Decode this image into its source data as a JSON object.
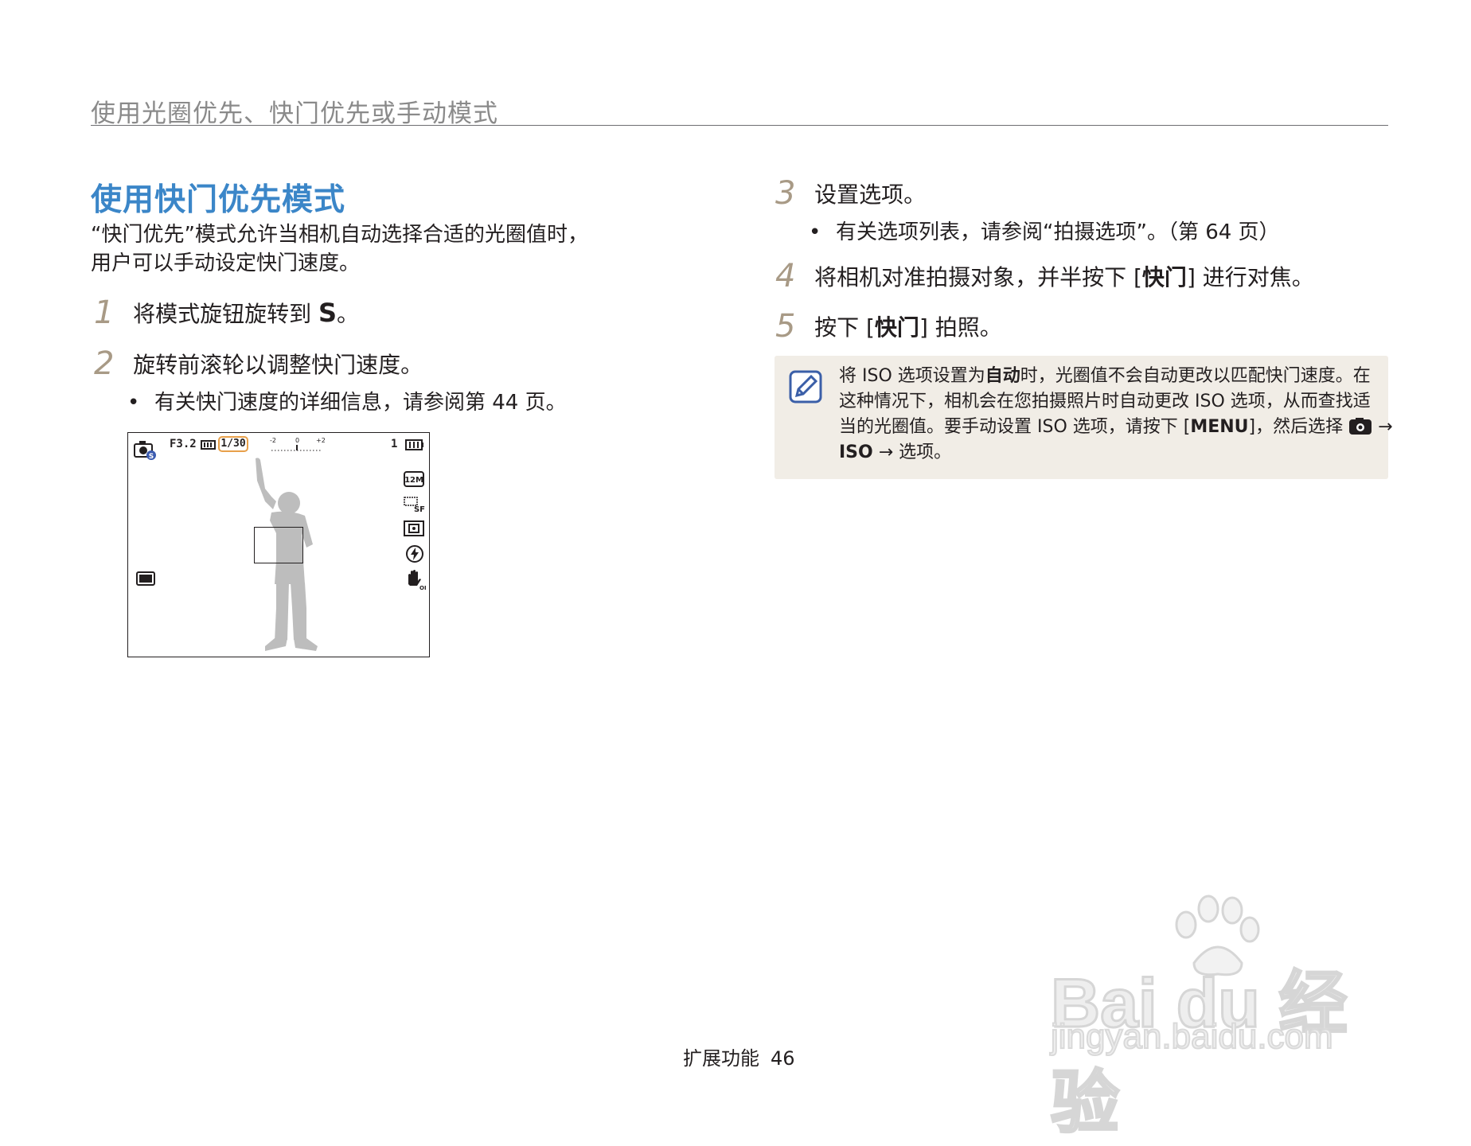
{
  "header": {
    "title": "使用光圈优先、快门优先或手动模式"
  },
  "section": {
    "title": "使用快门优先模式",
    "intro_lines": [
      "“快门优先”模式允许当相机自动选择合适的光圈值时，",
      "用户可以手动设定快门速度。"
    ]
  },
  "steps": [
    {
      "num": "1",
      "pre": "将模式旋钮旋转到 ",
      "strong": "S",
      "post": "。"
    },
    {
      "num": "2",
      "pre": "旋转前滚轮以调整快门速度。",
      "strong": "",
      "post": ""
    },
    {
      "num": "3",
      "pre": "设置选项。",
      "strong": "",
      "post": ""
    },
    {
      "num": "4",
      "pre": "将相机对准拍摄对象，并半按下 [",
      "strong": "快门",
      "post": "] 进行对焦。"
    },
    {
      "num": "5",
      "pre": "按下 [",
      "strong": "快门",
      "post": "] 拍照。"
    }
  ],
  "bullets": [
    {
      "dot": "•",
      "text": "有关快门速度的详细信息，请参阅第 44 页。"
    },
    {
      "dot": "•",
      "text": "有关选项列表，请参阅“拍摄选项”。（第 64 页）"
    }
  ],
  "viewfinder": {
    "aperture": "F3.2",
    "shutter": "1/30",
    "exposure_scale": "-2 ..... 0 ..... +2",
    "shots_remaining": "1",
    "right_icons": [
      "12m-icon",
      "sf-quality-icon",
      "metering-icon",
      "flash-off-icon",
      "ois-icon"
    ],
    "accent": "#e8a04a"
  },
  "note": {
    "icon": "note-pencil-icon",
    "line1_pre": "将 ISO 选项设置为",
    "line1_strong": "自动",
    "line1_post": "时，光圈值不会自动更改以匹配快门速度。在",
    "line2": "这种情况下，相机会在您拍摄照片时自动更改 ISO 选项，从而查找适",
    "line3_pre": "当的光圈值。要手动设置 ISO 选项，请按下 [",
    "line3_strong": "MENU",
    "line3_post": "]，然后选择 ",
    "line3_arrow": "→",
    "line4_strong": "ISO",
    "line4_post": " → 选项。"
  },
  "watermark": {
    "logo": "Bai du 经验",
    "url": "jingyan.baidu.com"
  },
  "footer": {
    "label": "扩展功能",
    "page": "46"
  },
  "colors": {
    "title_blue": "#3b86c8",
    "step_num": "#a89a86",
    "note_bg": "#f1ede6",
    "rule": "#6d6e71"
  }
}
